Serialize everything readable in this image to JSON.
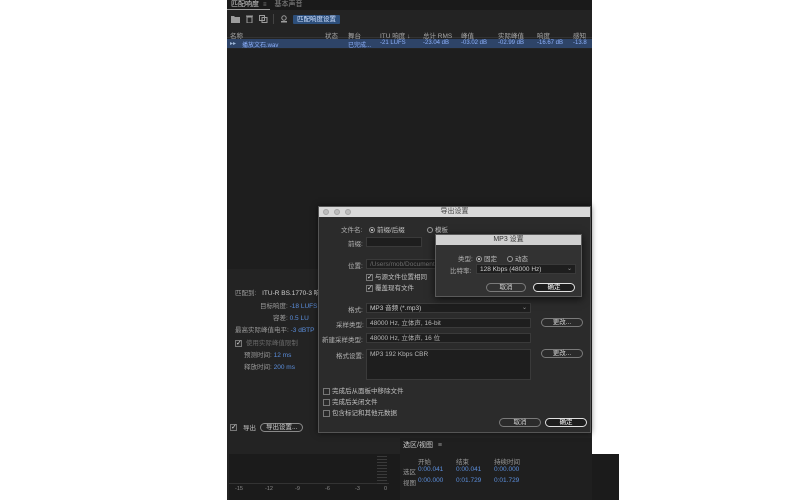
{
  "tabs": [
    {
      "label": "匹配响度",
      "menu": "≡"
    },
    {
      "label": "基本声音"
    }
  ],
  "toolbar": {
    "match_settings_label": "匹配响度设置"
  },
  "table": {
    "headers": [
      "名称",
      "状态",
      "舞台",
      "ITU 响度 ↓",
      "总计 RMS",
      "峰值",
      "实际峰值",
      "响度",
      "感知"
    ],
    "rows": [
      {
        "name": "播放文石.wav",
        "status": "",
        "stage": "已完成...",
        "itu": "-21 LUFS",
        "rms": "-23.04 dB",
        "peak": "-03.02 dB",
        "true_peak": "-02.99 dB",
        "loudness": "-16.67 dB",
        "perceived": "-13.8"
      }
    ]
  },
  "match_panel": {
    "match_to_label": "匹配到:",
    "match_to_value": "ITU-R BS.1770-3 响度",
    "target_label": "目标响度:",
    "target_value": "-18 LUFS",
    "tolerance_label": "容差:",
    "tolerance_value": "0.5 LU",
    "max_peak_label": "最高实际峰值电平:",
    "max_peak_value": "-3 dBTP",
    "limit_label": "使用实际峰值限制",
    "lookahead_label": "预测时间:",
    "lookahead_value": "12 ms",
    "release_label": "释放时间:",
    "release_value": "200 ms"
  },
  "export_bar": {
    "export_label": "导出",
    "settings_button": "导出设置..."
  },
  "meter": {
    "ticks": [
      "-15",
      "-12",
      "-9",
      "-6",
      "-3",
      "0"
    ]
  },
  "selection": {
    "title": "选区/视图",
    "menu": "≡",
    "col_start": "开始",
    "col_end": "结束",
    "col_duration": "持续时间",
    "row_selection": "选区",
    "row_view": "视图",
    "sel_start": "0:00.041",
    "sel_end": "0:00.041",
    "sel_duration": "0:00.000",
    "view_start": "0:00.000",
    "view_end": "0:01.729",
    "view_duration": "0:01.729"
  },
  "dialog": {
    "title": "导出设置",
    "filename_label": "文件名:",
    "opt_prefix": "前缀/后缀",
    "opt_template": "模板",
    "prefix_label": "前缀:",
    "prefix_value": "",
    "location_label": "位置:",
    "location_value": "/Users/mob/Documents",
    "same_as_source": "与源文件位置相同",
    "overwrite": "覆盖现有文件",
    "format_label": "格式:",
    "format_value": "MP3 音频 (*.mp3)",
    "sample_type_label": "采样类型:",
    "sample_type_value": "48000 Hz, 立体声, 16-bit",
    "change_button": "更改...",
    "new_sample_label": "新建采样类型:",
    "new_sample_value": "48000 Hz, 立体声, 16 位",
    "format_settings_label": "格式设置:",
    "format_settings_value": "MP3 192 Kbps CBR",
    "remove_after": "完成后从面板中移除文件",
    "close_after": "完成后关闭文件",
    "include_markers": "包含标记和其他元数据",
    "cancel": "取消",
    "ok": "确定"
  },
  "mp3_dialog": {
    "title": "MP3 设置",
    "type_label": "类型:",
    "type_constant": "固定",
    "type_variable": "动态",
    "bitrate_label": "比特率:",
    "bitrate_value": "128 Kbps (48000 Hz)",
    "cancel": "取消",
    "ok": "确定"
  }
}
